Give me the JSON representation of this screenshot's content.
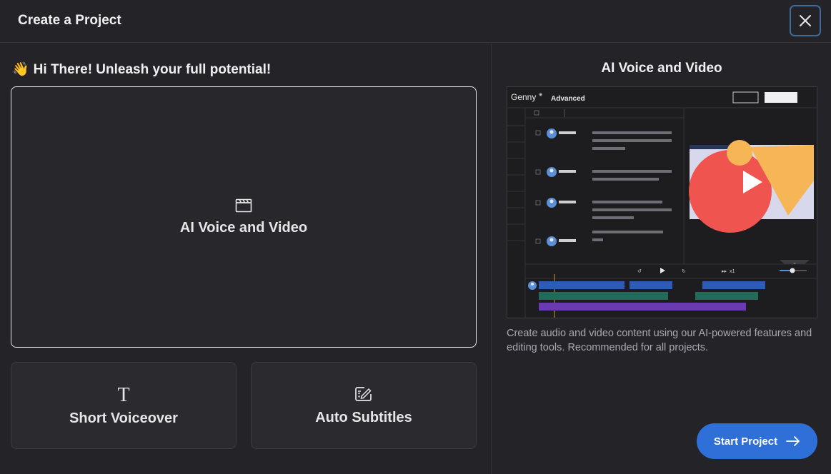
{
  "dialog": {
    "title": "Create a Project"
  },
  "greeting": {
    "emoji": "👋",
    "text": "Hi There! Unleash your full potential!"
  },
  "options": {
    "ai_voice_video": "AI Voice and Video",
    "short_voiceover": "Short Voiceover",
    "auto_subtitles": "Auto Subtitles"
  },
  "preview": {
    "title": "AI Voice and Video",
    "app_name": "Genny",
    "mode": "Advanced",
    "speed": "x1",
    "description": "Create audio and video content using our AI-powered features and editing tools. Recommended for all projects."
  },
  "actions": {
    "start": "Start Project"
  },
  "colors": {
    "accent": "#2f6fd8",
    "focus_border": "#3f6b9a"
  }
}
